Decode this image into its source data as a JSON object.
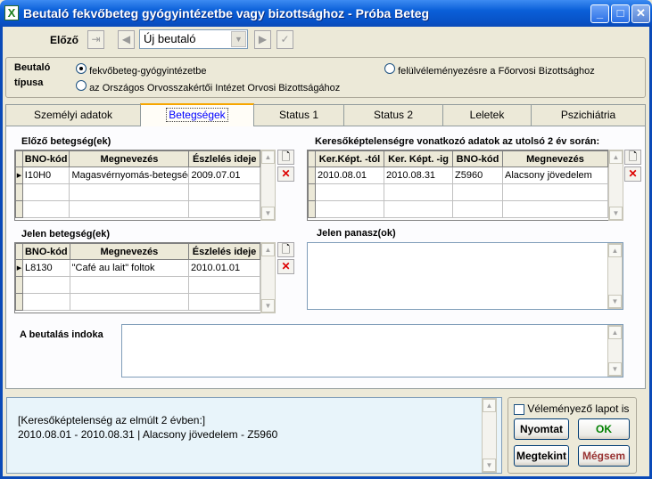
{
  "window": {
    "title": "Beutaló fekvőbeteg gyógyintézetbe vagy bizottsághoz  -  Próba Beteg",
    "app_icon": "X",
    "minimize": "_",
    "maximize": "□",
    "close": "✕"
  },
  "toolbar": {
    "prev_label": "Előző",
    "combo_value": "Új beutaló"
  },
  "referral_type": {
    "label_line1": "Beutaló",
    "label_line2": "típusa",
    "options": [
      {
        "label": "fekvőbeteg-gyógyintézetbe",
        "checked": true
      },
      {
        "label": "az Országos Orvosszakértői Intézet Orvosi Bizottságához",
        "checked": false
      },
      {
        "label": "felülvéleményezésre a Főorvosi Bizottsághoz",
        "checked": false
      }
    ]
  },
  "tabs": [
    "Személyi adatok",
    "Betegségek",
    "Status 1",
    "Status 2",
    "Leletek",
    "Pszichiátria"
  ],
  "previous_diseases": {
    "title": "Előző betegség(ek)",
    "headers": [
      "BNO-kód",
      "Megnevezés",
      "Észlelés ideje"
    ],
    "rows": [
      [
        "I10H0",
        "Magasvérnyomás-betegség",
        "2009.07.01"
      ]
    ]
  },
  "incapacity": {
    "title": "Keresőképtelenségre vonatkozó adatok az utolsó 2 év során:",
    "headers": [
      "Ker.Képt. -tól",
      "Ker. Képt. -ig",
      "BNO-kód",
      "Megnevezés"
    ],
    "rows": [
      [
        "2010.08.01",
        "2010.08.31",
        "Z5960",
        "Alacsony jövedelem"
      ]
    ]
  },
  "current_diseases": {
    "title": "Jelen betegség(ek)",
    "headers": [
      "BNO-kód",
      "Megnevezés",
      "Észlelés ideje"
    ],
    "rows": [
      [
        "L8130",
        "\"Café au lait\" foltok",
        "2010.01.01"
      ]
    ]
  },
  "complaints": {
    "title": "Jelen panasz(ok)"
  },
  "reason": {
    "title": "A beutalás indoka"
  },
  "info": {
    "line1": "[Keresőképtelenség az elmúlt 2 évben:]",
    "line2": "2010.08.01 - 2010.08.31 | Alacsony jövedelem - Z5960"
  },
  "actions": {
    "opinion_sheet": "Véleményező lapot is",
    "print": "Nyomtat",
    "ok": "OK",
    "view": "Megtekint",
    "cancel": "Mégsem"
  },
  "colors": {
    "ok": "#008000",
    "cancel": "#993333",
    "title_bar": "#0a5fd8"
  }
}
